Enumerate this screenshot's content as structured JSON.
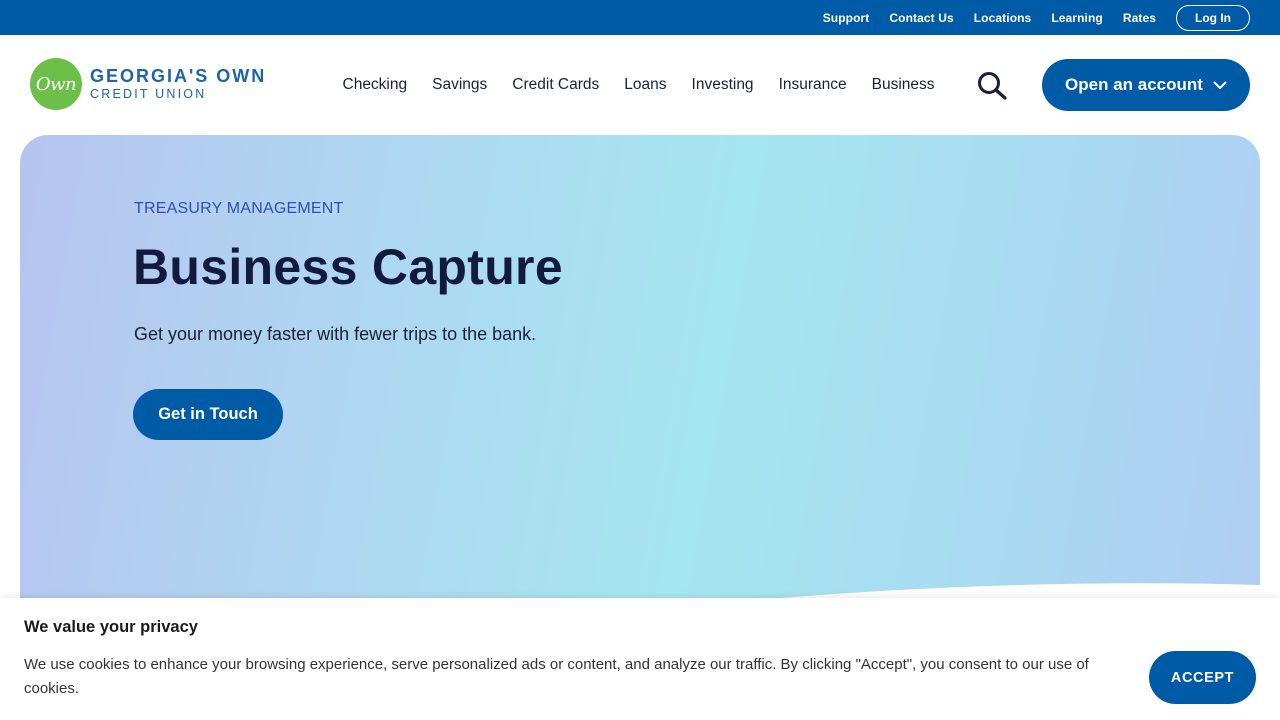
{
  "utility_nav": {
    "links": [
      "Support",
      "Contact Us",
      "Locations",
      "Learning",
      "Rates"
    ],
    "login_label": "Log In",
    "bg_color": "#005ba7"
  },
  "header": {
    "logo": {
      "badge_text": "Own",
      "line1": "GEORGIA'S OWN",
      "line2": "CREDIT UNION",
      "badge_color": "#6cc04a"
    },
    "nav_items": [
      "Checking",
      "Savings",
      "Credit Cards",
      "Loans",
      "Investing",
      "Insurance",
      "Business"
    ],
    "search_icon": "search-icon",
    "open_account_label": "Open an account",
    "open_account_icon": "chevron-down-icon"
  },
  "hero": {
    "eyebrow": "TREASURY MANAGEMENT",
    "title": "Business Capture",
    "subtitle": "Get your money faster with fewer trips to the bank.",
    "cta_label": "Get in Touch"
  },
  "cookie_banner": {
    "title": "We value your privacy",
    "text": "We use cookies to enhance your browsing experience, serve personalized ads or content, and analyze our traffic. By clicking \"Accept\", you consent to our use of cookies.",
    "accept_label": "ACCEPT"
  },
  "colors": {
    "brand_blue": "#005ba7",
    "heading_navy": "#121a3e",
    "eyebrow_blue": "#2f4eb8"
  }
}
